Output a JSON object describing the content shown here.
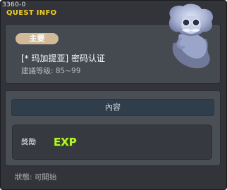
{
  "window": {
    "quest_id": "3360-0",
    "title": "QUEST INFO"
  },
  "info": {
    "type_badge": "主要",
    "quest_name": "[* 玛加提亚] 密码认证",
    "level_range": "建議等级: 85~99"
  },
  "content": {
    "header": "內容",
    "reward_label": "獎勵",
    "reward_type": "EXP"
  },
  "status": "狀態: 可開始",
  "colors": {
    "title_yellow": "#f4d021",
    "badge_tan": "#d2b998",
    "exp_green": "#b5f52a"
  },
  "icons": {
    "npc_portrait": "ghost-scientist-portrait",
    "reward": "exp-icon"
  }
}
